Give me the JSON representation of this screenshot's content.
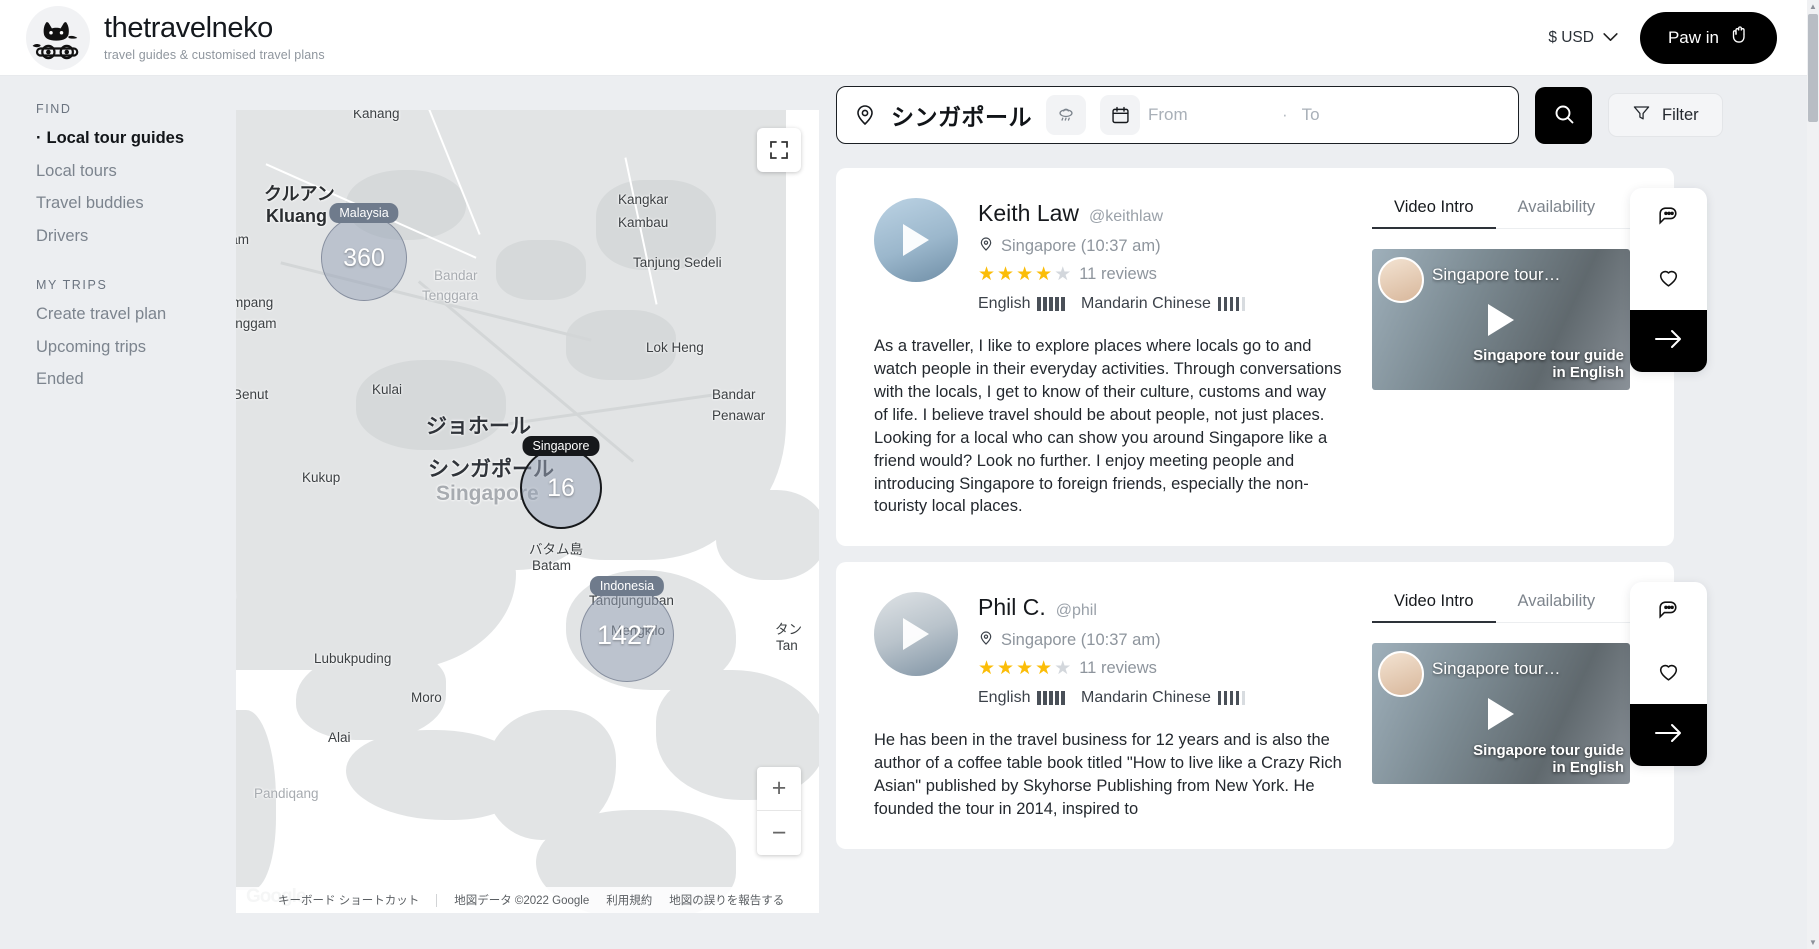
{
  "header": {
    "brand_title": "thetravelneko",
    "brand_tagline": "travel guides & customised travel plans",
    "currency_label": "$ USD",
    "signin_label": "Paw in"
  },
  "sidebar": {
    "groups": [
      {
        "heading": "FIND",
        "items": [
          {
            "label": "Local tour guides",
            "active": true
          },
          {
            "label": "Local tours",
            "active": false
          },
          {
            "label": "Travel buddies",
            "active": false
          },
          {
            "label": "Drivers",
            "active": false
          }
        ]
      },
      {
        "heading": "MY TRIPS",
        "items": [
          {
            "label": "Create travel plan",
            "active": false
          },
          {
            "label": "Upcoming trips",
            "active": false
          },
          {
            "label": "Ended",
            "active": false
          }
        ]
      }
    ]
  },
  "search": {
    "location_value": "シンガポール",
    "date_from_placeholder": "From",
    "date_to_placeholder": "To",
    "date_separator": "·",
    "filter_label": "Filter"
  },
  "map": {
    "clusters": [
      {
        "name": "Malaysia",
        "count": "360",
        "style": "light"
      },
      {
        "name": "Singapore",
        "count": "16",
        "style": "dark"
      },
      {
        "name": "Indonesia",
        "count": "1427",
        "style": "light"
      }
    ],
    "labels": [
      "Kahang",
      "クルアン",
      "Kluang",
      "er Hitam",
      "Simpang",
      "Renggam",
      "Benut",
      "Kulai",
      "Kangkar",
      "Kambau",
      "Tanjung Sedeli",
      "Lok Heng",
      "Bandar",
      "Penawar",
      "Bandar",
      "Tenggara",
      "ジョホール",
      "シンガポール",
      "Singapore",
      "Kukup",
      "バタム島",
      "Batam",
      "Tandjunguban",
      "Mengkilo",
      "Lubukpuding",
      "Moro",
      "Alai",
      "タン",
      "Tan",
      "a",
      "Pandiqang"
    ],
    "zoom_in": "+",
    "zoom_out": "−",
    "attribution": {
      "keyboard_shortcuts": "キーボード ショートカット",
      "map_data": "地図データ ©2022 Google",
      "terms": "利用規約",
      "report": "地図の誤りを報告する",
      "logo": "Google"
    }
  },
  "guides": [
    {
      "name": "Keith Law",
      "handle": "@keithlaw",
      "location": "Singapore (10:37 am)",
      "stars_filled": 4,
      "stars_total": 5,
      "reviews": "11 reviews",
      "languages": [
        {
          "name": "English",
          "level": 5,
          "max": 5
        },
        {
          "name": "Mandarin Chinese",
          "level": 4,
          "max": 5
        }
      ],
      "bio": "As a traveller, I like to explore places where locals go to and watch people in their everyday activities. Through conversations with the locals, I get to know of their culture, customs and way of life. I believe travel should be about people, not just places. Looking for a local who can show you around Singapore like a friend would? Look no further. I enjoy meeting people and introducing Singapore to foreign friends, especially the non-touristy local places.",
      "tabs": [
        {
          "label": "Video Intro",
          "active": true
        },
        {
          "label": "Availability",
          "active": false
        }
      ],
      "video": {
        "title": "Singapore tour…",
        "caption_line1": "Singapore tour guide",
        "caption_line2": "in English"
      }
    },
    {
      "name": "Phil C.",
      "handle": "@phil",
      "location": "Singapore (10:37 am)",
      "stars_filled": 4,
      "stars_total": 5,
      "reviews": "11 reviews",
      "languages": [
        {
          "name": "English",
          "level": 5,
          "max": 5
        },
        {
          "name": "Mandarin Chinese",
          "level": 4,
          "max": 5
        }
      ],
      "bio": "He has been in the travel business for 12 years and is also the author of a coffee table book titled \"How to live like a Crazy Rich Asian\" published by Skyhorse Publishing from New York. He founded the tour in 2014, inspired to",
      "tabs": [
        {
          "label": "Video Intro",
          "active": true
        },
        {
          "label": "Availability",
          "active": false
        }
      ],
      "video": {
        "title": "Singapore tour…",
        "caption_line1": "Singapore tour guide",
        "caption_line2": "in English"
      }
    }
  ],
  "icons": {
    "location_pin": "pin-icon",
    "weather": "ufo-weather-icon",
    "calendar": "calendar-icon",
    "search": "search-icon",
    "filter": "filter-icon",
    "chat": "chat-bubble-icon",
    "heart": "heart-icon",
    "arrow": "arrow-right-icon",
    "fullscreen": "fullscreen-icon"
  },
  "colors": {
    "accent": "#000000",
    "star": "#fbbd08",
    "page_bg": "#eceef1",
    "card_bg": "#ffffff"
  }
}
